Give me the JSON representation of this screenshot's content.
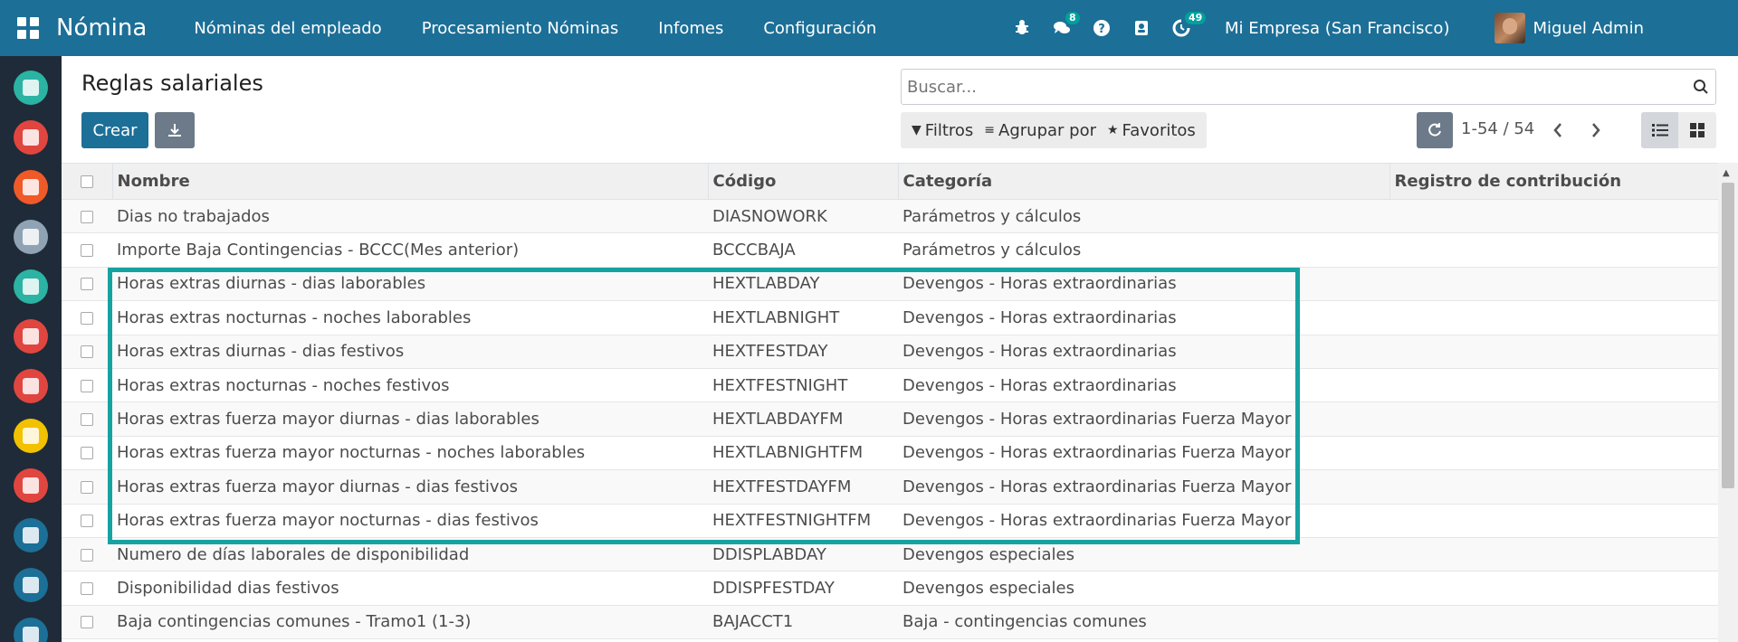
{
  "navbar": {
    "brand": "Nómina",
    "menu": [
      "Nóminas del empleado",
      "Procesamiento Nóminas",
      "Infomes",
      "Configuración"
    ],
    "chat_badge": "8",
    "activity_badge": "49",
    "company": "Mi Empresa (San Francisco)",
    "user": "Miguel Admin"
  },
  "dock": {
    "apps": [
      {
        "icon": "discuss-icon",
        "color": "#2bb3a3"
      },
      {
        "icon": "calendar-icon",
        "color": "#e0463f"
      },
      {
        "icon": "notes-icon",
        "color": "#f05a28"
      },
      {
        "icon": "contacts-icon",
        "color": "#8fa3b5"
      },
      {
        "icon": "employees-icon",
        "color": "#2bb3a3"
      },
      {
        "icon": "crm-icon",
        "color": "#e0463f"
      },
      {
        "icon": "reporting-icon",
        "color": "#e0463f"
      },
      {
        "icon": "recruitment-icon",
        "color": "#f2c200"
      },
      {
        "icon": "appraisal-icon",
        "color": "#e0463f"
      },
      {
        "icon": "pos-icon",
        "color": "#1c6f97"
      },
      {
        "icon": "calculator-icon",
        "color": "#1c6f97"
      },
      {
        "icon": "planning-icon",
        "color": "#1c6f97"
      }
    ]
  },
  "page": {
    "title": "Reglas salariales",
    "create_label": "Crear",
    "search_placeholder": "Buscar...",
    "filters_label": "Filtros",
    "group_by_label": "Agrupar por",
    "favorites_label": "Favoritos",
    "pager": "1-54 / 54"
  },
  "table": {
    "headers": [
      "Nombre",
      "Código",
      "Categoría",
      "Registro de contribución"
    ],
    "rows": [
      {
        "name": "Dias no trabajados",
        "code": "DIASNOWORK",
        "category": "Parámetros y cálculos",
        "contribution": ""
      },
      {
        "name": "Importe Baja Contingencias - BCCC(Mes anterior)",
        "code": "BCCCBAJA",
        "category": "Parámetros y cálculos",
        "contribution": ""
      },
      {
        "name": "Horas extras diurnas - dias laborables",
        "code": "HEXTLABDAY",
        "category": "Devengos - Horas extraordinarias",
        "contribution": ""
      },
      {
        "name": "Horas extras nocturnas - noches laborables",
        "code": "HEXTLABNIGHT",
        "category": "Devengos - Horas extraordinarias",
        "contribution": ""
      },
      {
        "name": "Horas extras diurnas - dias festivos",
        "code": "HEXTFESTDAY",
        "category": "Devengos - Horas extraordinarias",
        "contribution": ""
      },
      {
        "name": "Horas extras nocturnas - noches festivos",
        "code": "HEXTFESTNIGHT",
        "category": "Devengos - Horas extraordinarias",
        "contribution": ""
      },
      {
        "name": "Horas extras fuerza mayor diurnas - dias laborables",
        "code": "HEXTLABDAYFM",
        "category": "Devengos - Horas extraordinarias Fuerza Mayor",
        "contribution": ""
      },
      {
        "name": "Horas extras fuerza mayor nocturnas - noches laborables",
        "code": "HEXTLABNIGHTFM",
        "category": "Devengos - Horas extraordinarias Fuerza Mayor",
        "contribution": ""
      },
      {
        "name": "Horas extras fuerza mayor diurnas - dias festivos",
        "code": "HEXTFESTDAYFM",
        "category": "Devengos - Horas extraordinarias Fuerza Mayor",
        "contribution": ""
      },
      {
        "name": "Horas extras fuerza mayor nocturnas - dias festivos",
        "code": "HEXTFESTNIGHTFM",
        "category": "Devengos - Horas extraordinarias Fuerza Mayor",
        "contribution": ""
      },
      {
        "name": "Numero de días laborales de disponibilidad",
        "code": "DDISPLABDAY",
        "category": "Devengos especiales",
        "contribution": ""
      },
      {
        "name": "Disponibilidad dias festivos",
        "code": "DDISPFESTDAY",
        "category": "Devengos especiales",
        "contribution": ""
      },
      {
        "name": "Baja contingencias comunes - Tramo1 (1-3)",
        "code": "BAJACCT1",
        "category": "Baja - contingencias comunes",
        "contribution": ""
      }
    ]
  },
  "colors": {
    "primary": "#1c6f97",
    "highlight": "#17a2a2",
    "badge": "#00a09d"
  }
}
